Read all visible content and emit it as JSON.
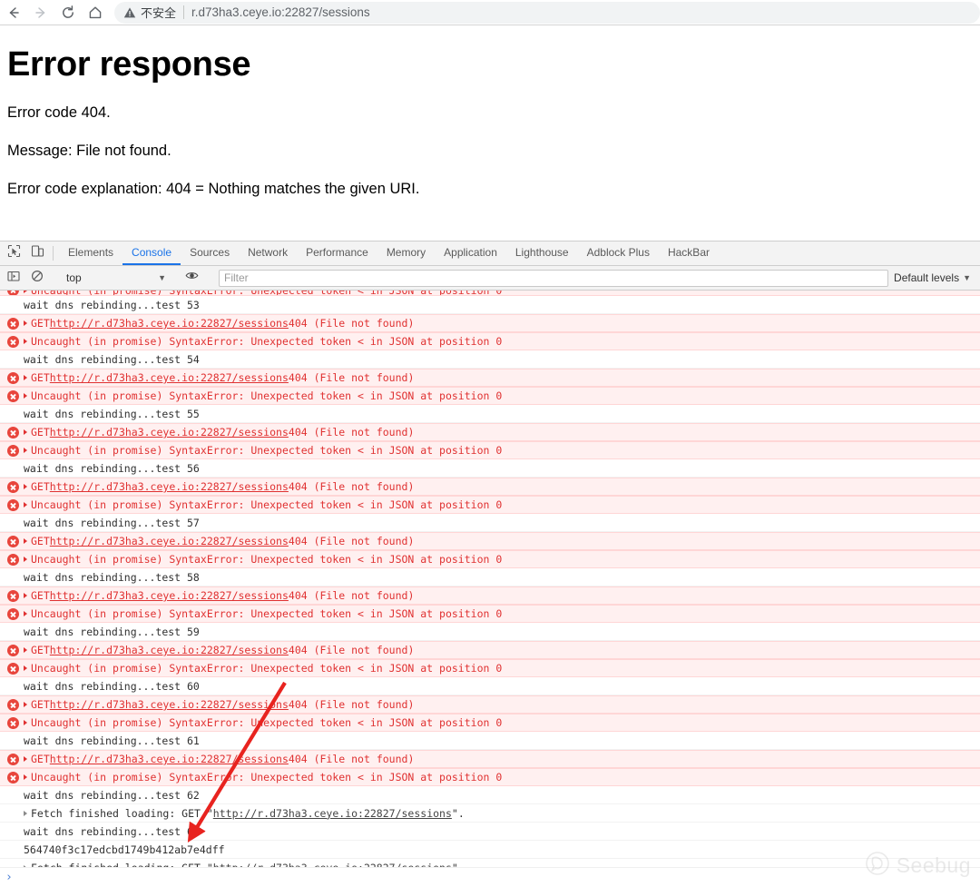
{
  "browser": {
    "nav": {
      "back": "back-arrow",
      "forward": "forward-arrow",
      "reload": "reload-icon",
      "home": "home-icon"
    },
    "omnibox": {
      "security_icon": "warning-triangle-icon",
      "security_text": "不安全",
      "url": "r.d73ha3.ceye.io:22827/sessions"
    }
  },
  "page": {
    "title": "Error response",
    "lines": [
      "Error code 404.",
      "Message: File not found.",
      "Error code explanation: 404 = Nothing matches the given URI."
    ]
  },
  "devtools": {
    "tools": {
      "inspect": "inspect-cursor-icon",
      "device": "device-toolbar-icon"
    },
    "tabs": [
      {
        "label": "Elements",
        "active": false
      },
      {
        "label": "Console",
        "active": true
      },
      {
        "label": "Sources",
        "active": false
      },
      {
        "label": "Network",
        "active": false
      },
      {
        "label": "Performance",
        "active": false
      },
      {
        "label": "Memory",
        "active": false
      },
      {
        "label": "Application",
        "active": false
      },
      {
        "label": "Lighthouse",
        "active": false
      },
      {
        "label": "Adblock Plus",
        "active": false
      },
      {
        "label": "HackBar",
        "active": false
      }
    ],
    "filterbar": {
      "sidebar_icon": "console-sidebar-icon",
      "clear_icon": "clear-console-icon",
      "context": "top",
      "context_caret": "▼",
      "eye_icon": "live-expression-eye-icon",
      "filter_placeholder": "Filter",
      "filter_value": "",
      "levels": "Default levels",
      "levels_caret": "▼"
    },
    "prompt_caret": "›",
    "colors": {
      "error_text": "#e03131",
      "error_bg": "#fff0f0",
      "active_tab": "#1a73e8",
      "annotation_arrow": "#e8231f"
    },
    "strings": {
      "url_full": "http://r.d73ha3.ceye.io:22827/sessions",
      "get_prefix": "GET ",
      "get_status": " 404 (File not found)",
      "syntax_error": "Uncaught (in promise) SyntaxError: Unexpected token < in JSON at position 0",
      "fetch_prefix": "Fetch finished loading: GET \"",
      "fetch_suffix": "\".",
      "hash": "564740f3c17edcbd1749b412ab7e4dff"
    },
    "rows": [
      {
        "type": "err-partial",
        "kind": "syntax"
      },
      {
        "type": "log",
        "text": "wait dns rebinding...test 53"
      },
      {
        "type": "err",
        "kind": "get"
      },
      {
        "type": "err",
        "kind": "syntax"
      },
      {
        "type": "log",
        "text": "wait dns rebinding...test 54"
      },
      {
        "type": "err",
        "kind": "get"
      },
      {
        "type": "err",
        "kind": "syntax"
      },
      {
        "type": "log",
        "text": "wait dns rebinding...test 55"
      },
      {
        "type": "err",
        "kind": "get"
      },
      {
        "type": "err",
        "kind": "syntax"
      },
      {
        "type": "log",
        "text": "wait dns rebinding...test 56"
      },
      {
        "type": "err",
        "kind": "get"
      },
      {
        "type": "err",
        "kind": "syntax"
      },
      {
        "type": "log",
        "text": "wait dns rebinding...test 57"
      },
      {
        "type": "err",
        "kind": "get"
      },
      {
        "type": "err",
        "kind": "syntax"
      },
      {
        "type": "log",
        "text": "wait dns rebinding...test 58"
      },
      {
        "type": "err",
        "kind": "get"
      },
      {
        "type": "err",
        "kind": "syntax"
      },
      {
        "type": "log",
        "text": "wait dns rebinding...test 59"
      },
      {
        "type": "err",
        "kind": "get"
      },
      {
        "type": "err",
        "kind": "syntax"
      },
      {
        "type": "log",
        "text": "wait dns rebinding...test 60"
      },
      {
        "type": "err",
        "kind": "get"
      },
      {
        "type": "err",
        "kind": "syntax"
      },
      {
        "type": "log",
        "text": "wait dns rebinding...test 61"
      },
      {
        "type": "err",
        "kind": "get"
      },
      {
        "type": "err",
        "kind": "syntax"
      },
      {
        "type": "log",
        "text": "wait dns rebinding...test 62"
      },
      {
        "type": "fetch"
      },
      {
        "type": "log",
        "text": "wait dns rebinding...test 63"
      },
      {
        "type": "plain",
        "text": "564740f3c17edcbd1749b412ab7e4dff"
      },
      {
        "type": "fetch"
      }
    ]
  },
  "watermark": {
    "text": "Seebug",
    "icon": "seebug-logo-icon"
  }
}
